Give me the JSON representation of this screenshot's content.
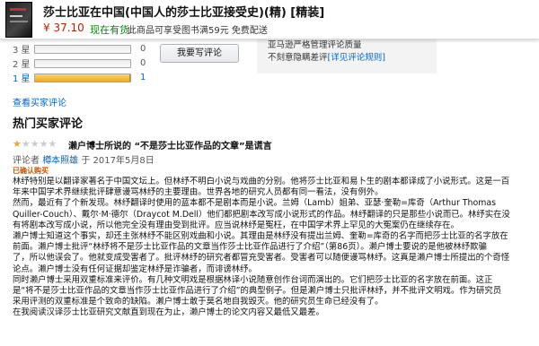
{
  "product": {
    "title": "莎士比亚在中国(中国人的莎士比亚接受史)(精) [精装]",
    "price": "¥ 37.10",
    "stock": "现在有货",
    "ship_note": "此商品可享受图书满59元 免费配送"
  },
  "histogram": [
    {
      "label": "3 星",
      "count": "0",
      "fraction": 0
    },
    {
      "label": "2 星",
      "count": "0",
      "fraction": 0
    },
    {
      "label": "1 星",
      "count": "1",
      "fraction": 1.0
    }
  ],
  "write_review_label": "我要写评论",
  "policy": {
    "line1": "亚马逊严格管理评论质量",
    "line2_prefix": "不刻意隐瞒差评",
    "line2_link": "[详见评论规则]"
  },
  "see_all_link": "查看买家评论",
  "section_title": "热门买家评论",
  "review": {
    "rating": 1,
    "rating_max": 5,
    "title": "濑户博士所说的 “不是莎士比亚作品的文章”是谎言",
    "meta_prefix": "评论者",
    "author": "樽本照雄",
    "meta_suffix": "于 2017年5月8日",
    "verified": "已确认购买",
    "body_lines": [
      "林纾特别是以翻译家著名于中国文坛上。但林纾不明白小说与戏曲的分别。他将莎士比亚和易卜生的剧本都译成了小说形式。这是一百",
      "年来中国学术界继续批评肆意谩骂林纾的主要理由。世界各地的研究人员都有同一看法，没有例外。",
      "然而，最近有了个新发现。林纾翻译时使用的蓝本都不是剧本而是小说。兰姆（Lamb）姐弟、亚瑟·奎勒=库奇（Arthur Thomas",
      "Quiller-Couch）、戴尔·M·德尔（Draycot M.Dell）他们都把剧本改写成小说形式的作品。林纾翻译的只是那些小说而已。林纾实在没",
      "有将剧本改写成小说，所以他完全没有理由受到批评。应当说林纾是冤枉，在中国学术界上罕见的大冤案仍在继续存在。",
      "濑户博士知道这个事实，却还主张林纾不能区别戏曲和小说。其理由是林纾没有提出兰姆、奎勒=库奇的名字而把莎士比亚的名字放在",
      "前面。濑户博士批评“林纾将不是莎士比亚作品的文章当作莎士比亚作品进行了介绍”（第86页）。濑户博士要说的是他被林纾欺骗",
      "了，所以他误会了。他就变成受害者了。批评林纾的研究者都冒充受害者。受害者可以随便谩骂林纾。这真是濑户博士所提出的个奇怪",
      "论点。濑户博士没有任何证据却鉴定林纾是诈骗者，而诽谤林纾。",
      "同时濑户博士采用双重标准来评价。有几种文明戏是根据林译小说随意创作台词而演出的。它们把莎士比亚的名字放在前面。这正",
      "是“将不是莎士比亚作品的文章当作莎士比亚作品进行了介绍”的典型例子。但是濑户博士只批评林纾，并不批评文明戏。作为研究员",
      "采用评测的双重标准是个致命的缺陷。濑户博士敢于莫名地自我毁灭。他的研究员生命已经没有了。",
      "在我阅读汉译莎士比亚研究文献直到现在为止，濑户博士的论文内容又最低又最差。"
    ]
  }
}
